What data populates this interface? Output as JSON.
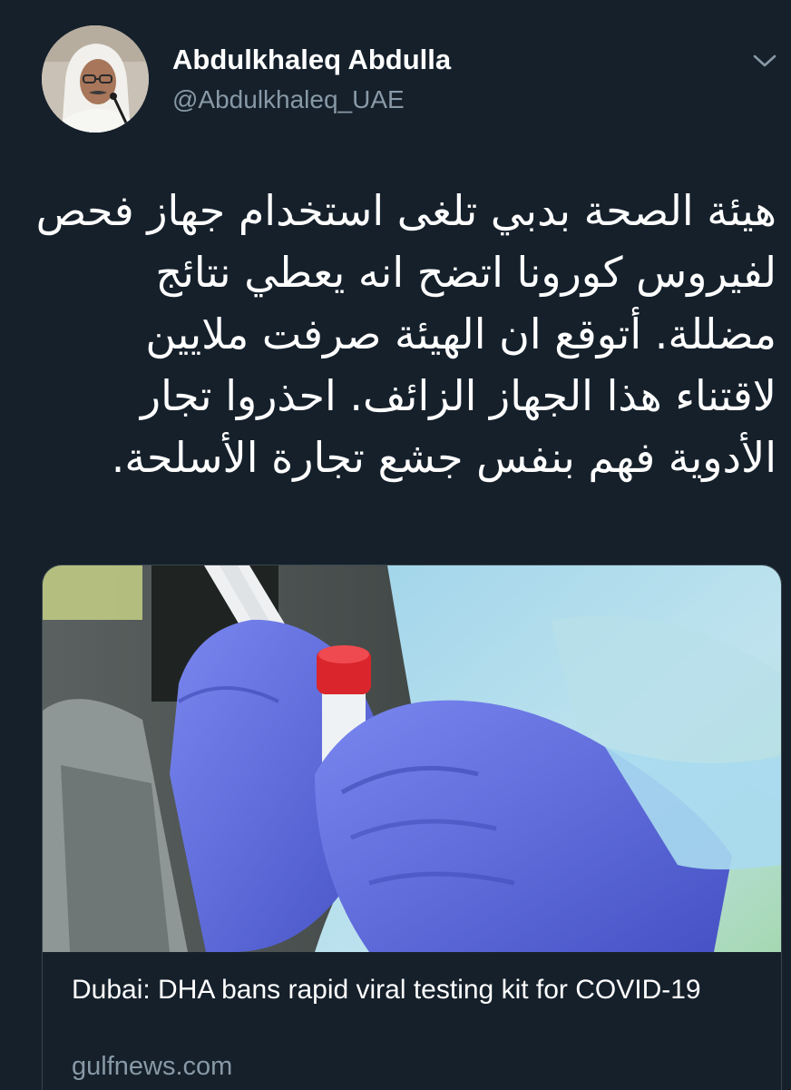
{
  "tweet": {
    "author": {
      "display_name": "Abdulkhaleq Abdulla",
      "handle": "@Abdulkhaleq_UAE",
      "avatar_icon": "user-avatar-photo"
    },
    "menu_icon": "chevron-down-icon",
    "text": "هيئة الصحة بدبي تلغى استخدام جهاز فحص لفيروس كورونا اتضح انه يعطي نتائج مضللة. أتوقع ان الهيئة صرفت ملايين لاقتناء هذا الجهاز الزائف. احذروا تجار الأدوية فهم بنفس جشع تجارة الأسلحة.",
    "link_card": {
      "image_description_icon": "covid-test-swab-photo",
      "title": "Dubai: DHA bans rapid viral testing kit for COVID-19",
      "domain": "gulfnews.com"
    }
  },
  "colors": {
    "background": "#15202b",
    "secondary_text": "#8899a6",
    "border": "#38444d",
    "glove": "#5b67d6",
    "cap": "#d9252b"
  }
}
